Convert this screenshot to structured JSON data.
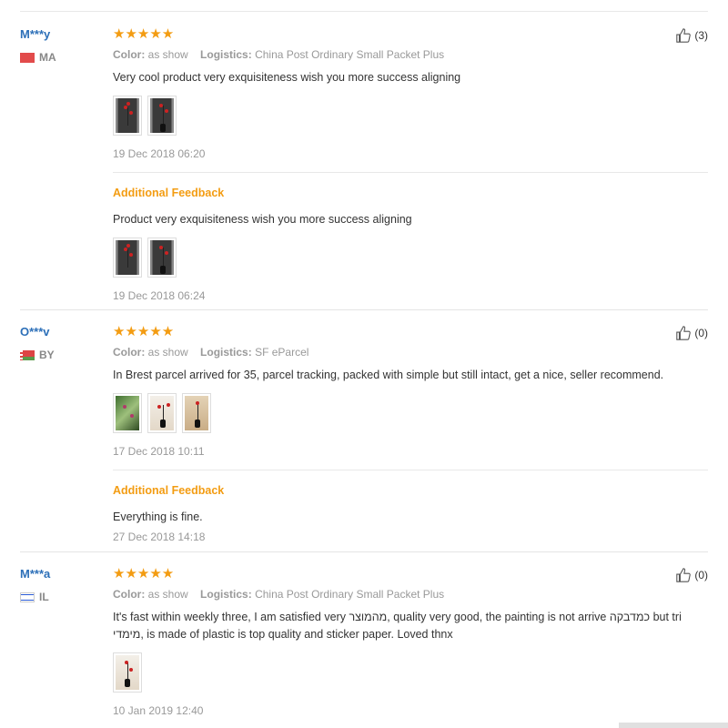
{
  "labels": {
    "color": "Color:",
    "logistics": "Logistics:",
    "additional_feedback": "Additional Feedback"
  },
  "reviews": [
    {
      "user": "M***y",
      "country": "MA",
      "stars": "★★★★★",
      "rating": 5,
      "color_value": "as show",
      "logistics_value": "China Post Ordinary Small Packet Plus",
      "text": "Very cool product very exquisiteness wish you more success aligning",
      "date": "19 Dec 2018 06:20",
      "helpful": "(3)",
      "additional": {
        "text": "Product very exquisiteness wish you more success aligning",
        "date": "19 Dec 2018 06:24"
      }
    },
    {
      "user": "O***v",
      "country": "BY",
      "stars": "★★★★★",
      "rating": 5,
      "color_value": "as show",
      "logistics_value": "SF eParcel",
      "text": "In Brest parcel arrived for 35, parcel tracking, packed with simple but still intact, get a nice, seller recommend.",
      "date": "17 Dec 2018 10:11",
      "helpful": "(0)",
      "additional": {
        "text": "Everything is fine.",
        "date": "27 Dec 2018 14:18"
      }
    },
    {
      "user": "M***a",
      "country": "IL",
      "stars": "★★★★★",
      "rating": 5,
      "color_value": "as show",
      "logistics_value": "China Post Ordinary Small Packet Plus",
      "text": "It's fast within weekly three, I am satisfied very מהמוצר, quality very good, the painting is not arrive כמדבקה but tri מימדי, is made of plastic is top quality and sticker paper. Loved thnx",
      "date": "10 Jan 2019 12:40",
      "helpful": "(0)"
    }
  ]
}
